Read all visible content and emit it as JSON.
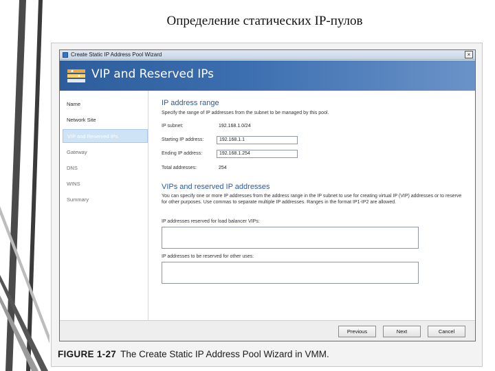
{
  "slide": {
    "title": "Определение статических IP-пулов"
  },
  "window": {
    "title": "Create Static IP Address Pool Wizard",
    "close_glyph": "×",
    "header_title": "VIP and Reserved IPs"
  },
  "nav": {
    "items": [
      {
        "label": "Name",
        "state": "done"
      },
      {
        "label": "Network Site",
        "state": "done"
      },
      {
        "label": "VIP and Reserved IPs",
        "state": "active"
      },
      {
        "label": "Gateway",
        "state": "pending"
      },
      {
        "label": "DNS",
        "state": "pending"
      },
      {
        "label": "WINS",
        "state": "pending"
      },
      {
        "label": "Summary",
        "state": "pending"
      }
    ]
  },
  "ip_range": {
    "title": "IP address range",
    "description": "Specify the range of IP addresses from the subnet to be managed by this pool.",
    "subnet_label": "IP subnet:",
    "subnet_value": "192.168.1.0/24",
    "start_label": "Starting IP address:",
    "start_value": "192.168.1.1",
    "end_label": "Ending IP address:",
    "end_value": "192.168.1.254",
    "total_label": "Total addresses:",
    "total_value": "254"
  },
  "vips": {
    "title": "VIPs and reserved IP addresses",
    "description": "You can specify one or more IP addresses from the address range in the IP subnet to use for creating virtual IP (VIP) addresses or to reserve for other purposes. Use commas to separate multiple IP addresses. Ranges in the format IP1-IP2 are allowed.",
    "lb_label": "IP addresses reserved for load balancer VIPs:",
    "lb_value": "",
    "other_label": "IP addresses to be reserved for other uses:",
    "other_value": ""
  },
  "buttons": {
    "previous": "Previous",
    "next": "Next",
    "cancel": "Cancel"
  },
  "caption": {
    "label": "FIGURE 1-27",
    "text": "The Create Static IP Address Pool Wizard in VMM."
  },
  "colors": {
    "header_band": "#3c6fb0",
    "section_title": "#2a5aa0",
    "nav_active": "#cfe3f6",
    "slide_stripe": "#3a3a3a"
  }
}
